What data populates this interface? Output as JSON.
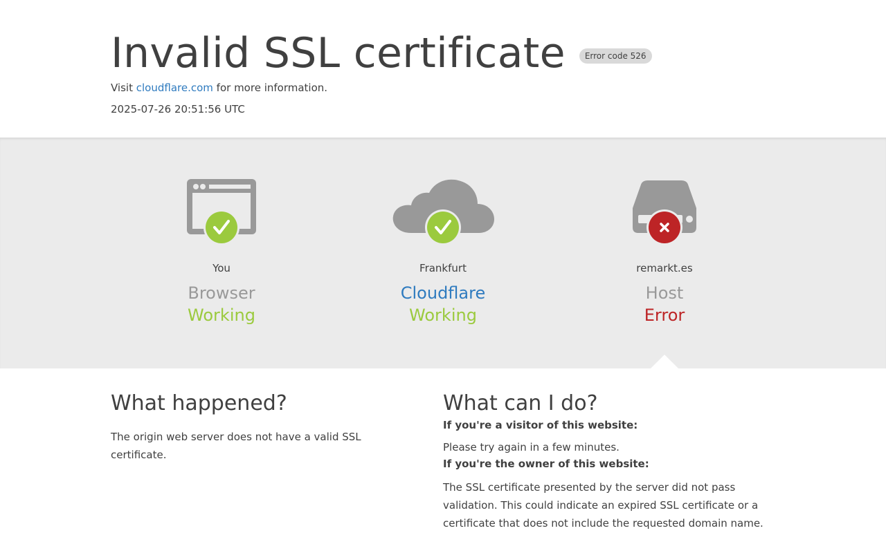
{
  "header": {
    "title": "Invalid SSL certificate",
    "error_badge": "Error code 526",
    "visit_prefix": "Visit",
    "visit_link": "cloudflare.com",
    "visit_suffix": "for more information.",
    "timestamp": "2025-07-26 20:51:56 UTC"
  },
  "nodes": [
    {
      "location": "You",
      "name": "Browser",
      "status": "Working",
      "icon": "browser-icon",
      "status_icon": "check-icon"
    },
    {
      "location": "Frankfurt",
      "name": "Cloudflare",
      "status": "Working",
      "icon": "cloud-icon",
      "status_icon": "check-icon"
    },
    {
      "location": "remarkt.es",
      "name": "Host",
      "status": "Error",
      "icon": "server-icon",
      "status_icon": "x-icon"
    }
  ],
  "what_happened": {
    "heading": "What happened?",
    "body": "The origin web server does not have a valid SSL certificate."
  },
  "what_can_i_do": {
    "heading": "What can I do?",
    "visitor_heading": "If you're a visitor of this website:",
    "visitor_body": "Please try again in a few minutes.",
    "owner_heading": "If you're the owner of this website:",
    "owner_body": "The SSL certificate presented by the server did not pass validation. This could indicate an expired SSL certificate or a certificate that does not include the requested domain name."
  },
  "colors": {
    "text": "#404040",
    "link": "#2f7bbf",
    "ok": "#9bca3e",
    "error": "#bd2426",
    "icon_gray": "#999999",
    "band": "#ebebeb"
  }
}
